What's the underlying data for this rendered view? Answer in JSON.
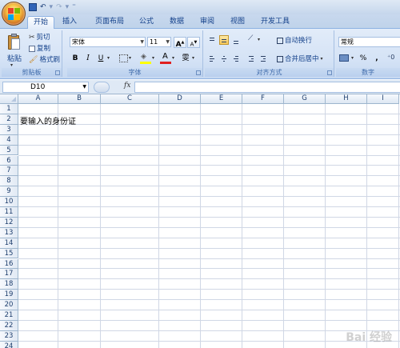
{
  "tabs": [
    "开始",
    "插入",
    "页面布局",
    "公式",
    "数据",
    "审阅",
    "视图",
    "开发工具"
  ],
  "clipboard": {
    "paste": "粘贴",
    "cut": "剪切",
    "copy": "复制",
    "format_painter": "格式刷",
    "label": "剪贴板"
  },
  "font": {
    "name": "宋体",
    "size": "11",
    "bold": "B",
    "italic": "I",
    "underline": "U",
    "grow": "A",
    "shrink": "A",
    "phonetic": "雯",
    "label": "字体",
    "font_color": "#e02020",
    "fill_color": "#ffff00"
  },
  "alignment": {
    "wrap_text": "自动换行",
    "merge_center": "合并后居中",
    "label": "对齐方式"
  },
  "number": {
    "format": "常规",
    "percent": "%",
    "comma": ",",
    "label": "数字"
  },
  "formula_bar": {
    "name_box": "D10",
    "fx": "fx",
    "content": ""
  },
  "sheet": {
    "columns": [
      "A",
      "B",
      "C",
      "D",
      "E",
      "F",
      "G",
      "H",
      "I"
    ],
    "rows": [
      "1",
      "2",
      "3",
      "4",
      "5",
      "6",
      "7",
      "8",
      "9",
      "10",
      "11",
      "12",
      "13",
      "14",
      "15",
      "16",
      "17",
      "18",
      "19",
      "20",
      "21",
      "22",
      "23",
      "24"
    ],
    "cells": {
      "A2": "要输入的身份证"
    }
  },
  "watermark": "Bai 经验"
}
